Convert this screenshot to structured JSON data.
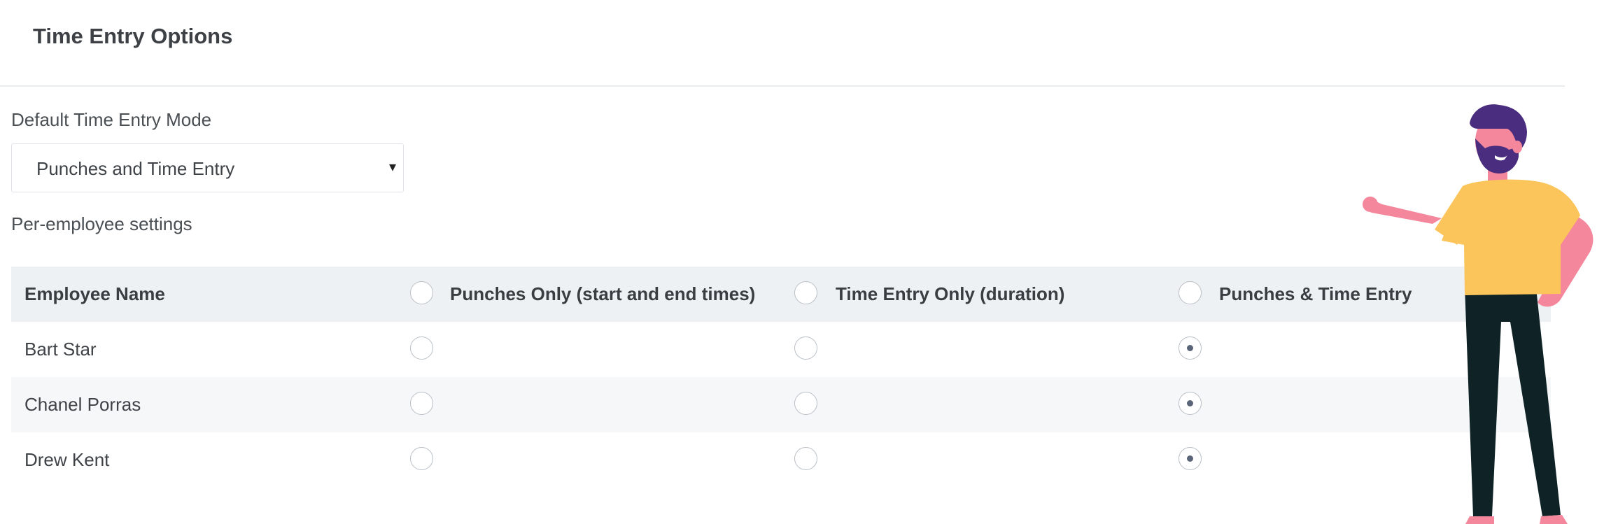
{
  "page": {
    "title": "Time Entry Options"
  },
  "default_mode": {
    "label": "Default Time Entry Mode",
    "selected_value": "Punches and Time Entry",
    "caret": "▾"
  },
  "per_employee": {
    "label": "Per-employee settings"
  },
  "table": {
    "header": {
      "name_col": "Employee Name",
      "options": [
        "Punches Only (start and end times)",
        "Time Entry Only (duration)",
        "Punches & Time Entry"
      ]
    },
    "rows": [
      {
        "name": "Bart Star",
        "selected_option_index": 2
      },
      {
        "name": "Chanel Porras",
        "selected_option_index": 2
      },
      {
        "name": "Drew Kent",
        "selected_option_index": 2
      }
    ]
  },
  "colors": {
    "header_bg": "#eef1f4",
    "shaded_row_bg": "#f5f7f9",
    "radio_dot": "#5a6478",
    "illustration_hair": "#4b2d7f",
    "illustration_skin": "#f4879c",
    "illustration_shirt": "#fbc55b",
    "illustration_pants": "#0f2326"
  },
  "icons": {
    "select_caret": "chevron-down-icon",
    "illustration": "pointing-person-illustration"
  }
}
